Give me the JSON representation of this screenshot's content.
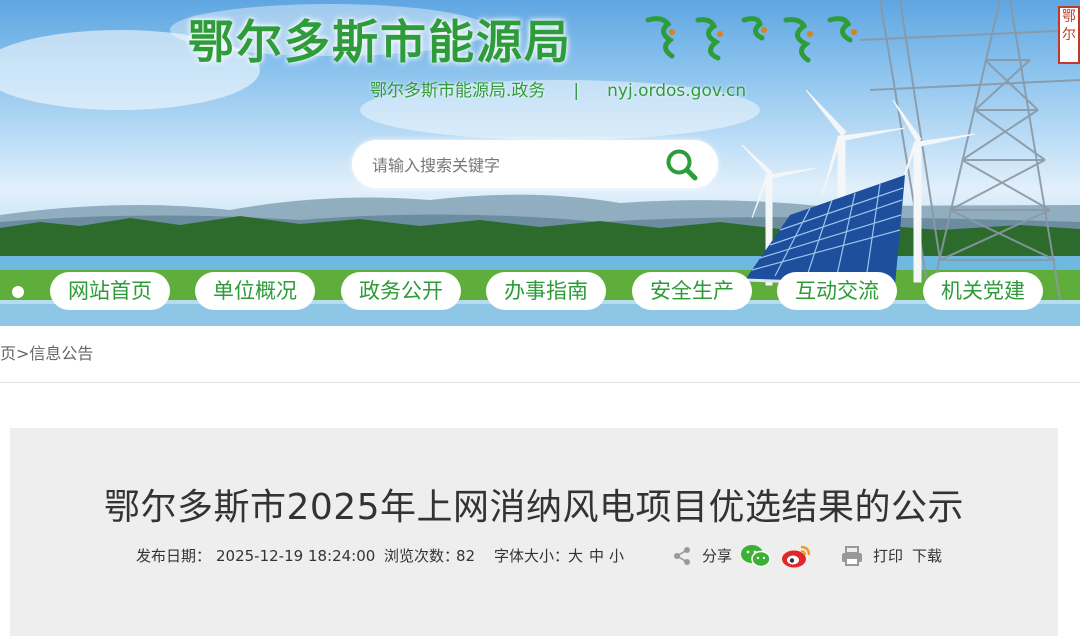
{
  "header": {
    "site_title": "鄂尔多斯市能源局",
    "sub_name": "鄂尔多斯市能源局.政务",
    "separator": "|",
    "domain": "nyj.ordos.gov.cn",
    "seal_text": "鄂尔多斯"
  },
  "search": {
    "placeholder": "请输入搜索关键字",
    "icon": "search-icon"
  },
  "nav": [
    {
      "label": "网站首页"
    },
    {
      "label": "单位概况"
    },
    {
      "label": "政务公开"
    },
    {
      "label": "办事指南"
    },
    {
      "label": "安全生产"
    },
    {
      "label": "互动交流"
    },
    {
      "label": "机关党建"
    }
  ],
  "breadcrumb": {
    "home": "首页",
    "separator": ">",
    "current": "信息公告"
  },
  "article": {
    "title": "鄂尔多斯市2025年上网消纳风电项目优选结果的公示",
    "publish_label": "发布日期：",
    "publish_date": "2025-12-19 18:24:00",
    "views_label": "浏览次数：",
    "views": "82",
    "font_label": "字体大小：",
    "font_large": "大",
    "font_medium": "中",
    "font_small": "小",
    "share_label": "分享",
    "print_label": "打印",
    "download_label": "下载"
  },
  "colors": {
    "brand_green": "#2f9c3b",
    "wechat": "#3cb034",
    "weibo": "#e0282a",
    "seal_red": "#c0392b"
  }
}
